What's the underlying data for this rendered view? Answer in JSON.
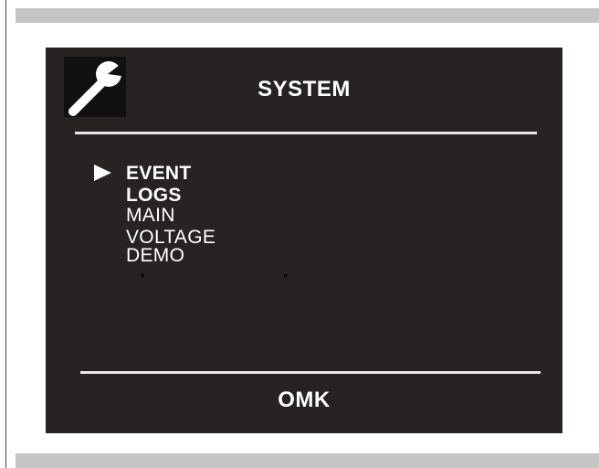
{
  "screen": {
    "title": "SYSTEM",
    "header_icon": "wrench-icon",
    "menu": {
      "items": [
        {
          "label": "EVENT LOGS",
          "selected": true
        },
        {
          "label": "MAIN VOLTAGE",
          "selected": false
        },
        {
          "label": "DEMO",
          "selected": false
        }
      ],
      "cursor_icon": "triangle-right-icon"
    },
    "footer_label": "OMK",
    "colors": {
      "panel_background": "#262322",
      "text": "#ffffff",
      "frame_band": "#c5c5c5"
    }
  }
}
